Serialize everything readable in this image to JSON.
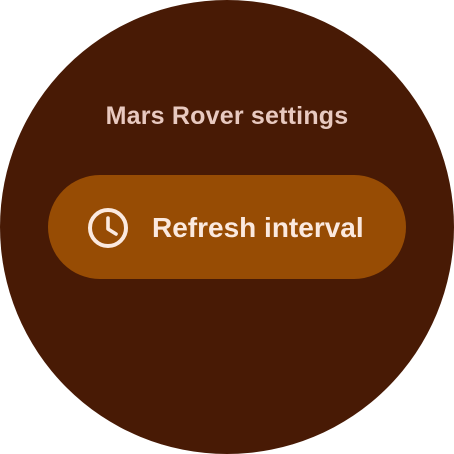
{
  "screen": {
    "title": "Mars Rover settings"
  },
  "settings": {
    "items": [
      {
        "label": "Refresh interval",
        "icon": "clock-icon"
      }
    ]
  },
  "colors": {
    "background": "#481a05",
    "chip": "#974c04",
    "title_text": "#e8c9c0",
    "chip_text": "#fbe9df"
  }
}
